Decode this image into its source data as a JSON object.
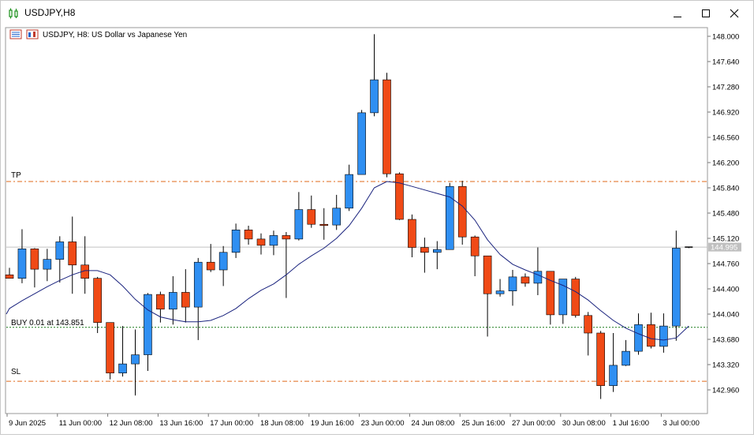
{
  "window": {
    "title": "USDJPY,H8",
    "controls": {
      "minimize": "minimize",
      "maximize": "maximize",
      "close": "close"
    }
  },
  "chart": {
    "header": "USDJPY, H8:  US Dollar vs Japanese Yen",
    "current_price": "144.995",
    "levels": {
      "tp_label": "TP",
      "buy_label": "BUY 0.01 at 143.851",
      "sl_label": "SL"
    },
    "colors": {
      "bull": "#2f8ff2",
      "bear": "#f04a16",
      "wick": "#000000",
      "ma": "#1a237e",
      "level_tp_sl": "#e06a1a",
      "level_buy": "#1b7a1b",
      "price_line": "#c0c0c0"
    }
  },
  "chart_data": {
    "type": "candlestick",
    "symbol": "USDJPY",
    "timeframe": "H8",
    "ylim": [
      142.8,
      148.06
    ],
    "yticks": [
      "148.000",
      "147.640",
      "147.280",
      "146.920",
      "146.560",
      "146.200",
      "145.840",
      "145.480",
      "145.120",
      "144.760",
      "144.400",
      "144.040",
      "143.680",
      "143.320",
      "142.960"
    ],
    "xticks": [
      "9 Jun 2025",
      "11 Jun 00:00",
      "12 Jun 08:00",
      "13 Jun 16:00",
      "17 Jun 00:00",
      "18 Jun 08:00",
      "19 Jun 16:00",
      "23 Jun 00:00",
      "24 Jun 08:00",
      "25 Jun 16:00",
      "27 Jun 00:00",
      "30 Jun 08:00",
      "1 Jul 16:00",
      "3 Jul 00:00"
    ],
    "horizontal_levels": {
      "tp": 145.93,
      "buy": 143.851,
      "sl": 143.083,
      "current": 144.995
    },
    "candles": [
      {
        "o": 144.6,
        "h": 144.7,
        "l": 144.55,
        "c": 144.55
      },
      {
        "o": 144.55,
        "h": 145.25,
        "l": 144.48,
        "c": 144.97
      },
      {
        "o": 144.97,
        "h": 144.98,
        "l": 144.42,
        "c": 144.68
      },
      {
        "o": 144.68,
        "h": 144.97,
        "l": 144.51,
        "c": 144.82
      },
      {
        "o": 144.82,
        "h": 145.15,
        "l": 144.49,
        "c": 145.07
      },
      {
        "o": 145.07,
        "h": 145.43,
        "l": 144.33,
        "c": 144.74
      },
      {
        "o": 144.74,
        "h": 145.15,
        "l": 144.33,
        "c": 144.55
      },
      {
        "o": 144.55,
        "h": 144.57,
        "l": 143.77,
        "c": 143.92
      },
      {
        "o": 143.92,
        "h": 143.92,
        "l": 143.11,
        "c": 143.2
      },
      {
        "o": 143.2,
        "h": 143.87,
        "l": 143.15,
        "c": 143.33
      },
      {
        "o": 143.33,
        "h": 143.82,
        "l": 142.88,
        "c": 143.46
      },
      {
        "o": 143.46,
        "h": 144.34,
        "l": 143.23,
        "c": 144.32
      },
      {
        "o": 144.32,
        "h": 144.36,
        "l": 143.92,
        "c": 144.11
      },
      {
        "o": 144.11,
        "h": 144.58,
        "l": 143.89,
        "c": 144.35
      },
      {
        "o": 144.35,
        "h": 144.68,
        "l": 143.92,
        "c": 144.14
      },
      {
        "o": 144.14,
        "h": 144.84,
        "l": 143.67,
        "c": 144.78
      },
      {
        "o": 144.78,
        "h": 145.04,
        "l": 144.64,
        "c": 144.67
      },
      {
        "o": 144.67,
        "h": 145.01,
        "l": 144.44,
        "c": 144.92
      },
      {
        "o": 144.92,
        "h": 145.33,
        "l": 144.84,
        "c": 145.24
      },
      {
        "o": 145.24,
        "h": 145.3,
        "l": 145.03,
        "c": 145.11
      },
      {
        "o": 145.11,
        "h": 145.19,
        "l": 144.89,
        "c": 145.02
      },
      {
        "o": 145.02,
        "h": 145.23,
        "l": 144.88,
        "c": 145.16
      },
      {
        "o": 145.16,
        "h": 145.21,
        "l": 144.27,
        "c": 145.11
      },
      {
        "o": 145.11,
        "h": 145.78,
        "l": 145.09,
        "c": 145.53
      },
      {
        "o": 145.53,
        "h": 145.73,
        "l": 145.27,
        "c": 145.32
      },
      {
        "o": 145.32,
        "h": 145.55,
        "l": 145.1,
        "c": 145.31
      },
      {
        "o": 145.31,
        "h": 145.74,
        "l": 145.24,
        "c": 145.55
      },
      {
        "o": 145.55,
        "h": 146.17,
        "l": 145.51,
        "c": 146.03
      },
      {
        "o": 146.03,
        "h": 146.95,
        "l": 146.12,
        "c": 146.91
      },
      {
        "o": 146.91,
        "h": 148.03,
        "l": 146.86,
        "c": 147.38
      },
      {
        "o": 147.38,
        "h": 147.48,
        "l": 145.99,
        "c": 146.04
      },
      {
        "o": 146.04,
        "h": 146.06,
        "l": 145.38,
        "c": 145.39
      },
      {
        "o": 145.39,
        "h": 145.46,
        "l": 144.85,
        "c": 144.99
      },
      {
        "o": 144.99,
        "h": 145.13,
        "l": 144.63,
        "c": 144.92
      },
      {
        "o": 144.92,
        "h": 145.08,
        "l": 144.68,
        "c": 144.96
      },
      {
        "o": 144.96,
        "h": 145.91,
        "l": 144.96,
        "c": 145.86
      },
      {
        "o": 145.86,
        "h": 145.94,
        "l": 145.03,
        "c": 145.14
      },
      {
        "o": 145.14,
        "h": 145.16,
        "l": 144.58,
        "c": 144.87
      },
      {
        "o": 144.87,
        "h": 144.87,
        "l": 143.72,
        "c": 144.33
      },
      {
        "o": 144.33,
        "h": 144.54,
        "l": 144.29,
        "c": 144.37
      },
      {
        "o": 144.37,
        "h": 144.67,
        "l": 144.16,
        "c": 144.57
      },
      {
        "o": 144.57,
        "h": 144.62,
        "l": 144.43,
        "c": 144.48
      },
      {
        "o": 144.48,
        "h": 144.99,
        "l": 144.31,
        "c": 144.65
      },
      {
        "o": 144.65,
        "h": 144.65,
        "l": 143.89,
        "c": 144.03
      },
      {
        "o": 144.03,
        "h": 144.52,
        "l": 143.9,
        "c": 144.54
      },
      {
        "o": 144.54,
        "h": 144.57,
        "l": 143.99,
        "c": 144.02
      },
      {
        "o": 144.02,
        "h": 144.07,
        "l": 143.45,
        "c": 143.77
      },
      {
        "o": 143.77,
        "h": 143.8,
        "l": 142.83,
        "c": 143.02
      },
      {
        "o": 143.02,
        "h": 143.77,
        "l": 142.93,
        "c": 143.31
      },
      {
        "o": 143.31,
        "h": 143.67,
        "l": 143.3,
        "c": 143.51
      },
      {
        "o": 143.51,
        "h": 144.05,
        "l": 143.46,
        "c": 143.89
      },
      {
        "o": 143.89,
        "h": 144.06,
        "l": 143.55,
        "c": 143.58
      },
      {
        "o": 143.58,
        "h": 144.05,
        "l": 143.49,
        "c": 143.87
      },
      {
        "o": 143.87,
        "h": 145.23,
        "l": 143.66,
        "c": 144.98
      },
      {
        "o": 144.98,
        "h": 145.0,
        "l": 144.98,
        "c": 144.995
      }
    ],
    "ma": [
      144.12,
      144.23,
      144.33,
      144.43,
      144.52,
      144.6,
      144.66,
      144.66,
      144.6,
      144.44,
      144.25,
      144.1,
      144.0,
      143.96,
      143.93,
      143.93,
      143.95,
      144.02,
      144.12,
      144.26,
      144.38,
      144.47,
      144.6,
      144.75,
      144.87,
      144.98,
      145.12,
      145.3,
      145.55,
      145.84,
      145.93,
      145.91,
      145.86,
      145.81,
      145.76,
      145.71,
      145.58,
      145.38,
      145.1,
      144.89,
      144.75,
      144.67,
      144.6,
      144.52,
      144.45,
      144.36,
      144.24,
      144.09,
      143.95,
      143.84,
      143.76,
      143.69,
      143.67,
      143.7,
      143.87
    ]
  }
}
